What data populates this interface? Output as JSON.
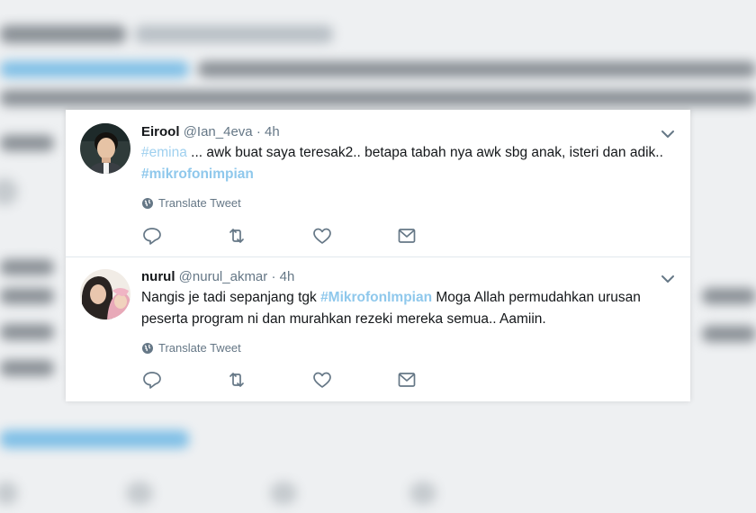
{
  "tweets": [
    {
      "display_name": "Eirool",
      "handle": "@Ian_4eva",
      "separator": "·",
      "time": "4h",
      "text_parts": [
        "#emina",
        " ... awk buat saya teresak2.. betapa tabah nya awk sbg anak, isteri dan adik.. ",
        "#mikrofonimpian"
      ],
      "translate_label": "Translate Tweet",
      "avatar_icon": "profile-photo-man"
    },
    {
      "display_name": "nurul",
      "handle": "@nurul_akmar",
      "separator": "·",
      "time": "4h",
      "text_parts": [
        "Nangis je tadi sepanjang tgk ",
        "#MikrofonImpian",
        " Moga Allah permudahkan urusan peserta program ni dan murahkan rezeki mereka semua.. Aamiin."
      ],
      "translate_label": "Translate Tweet",
      "avatar_icon": "profile-photo-woman-hijab"
    }
  ],
  "icons": {
    "reply": "reply-icon",
    "retweet": "retweet-icon",
    "like": "like-icon",
    "message": "direct-message-icon",
    "globe": "globe-icon",
    "chevron": "chevron-down-icon"
  },
  "colors": {
    "hashtag": "#8fc8ec",
    "text": "#14171a",
    "muted": "#657786"
  }
}
